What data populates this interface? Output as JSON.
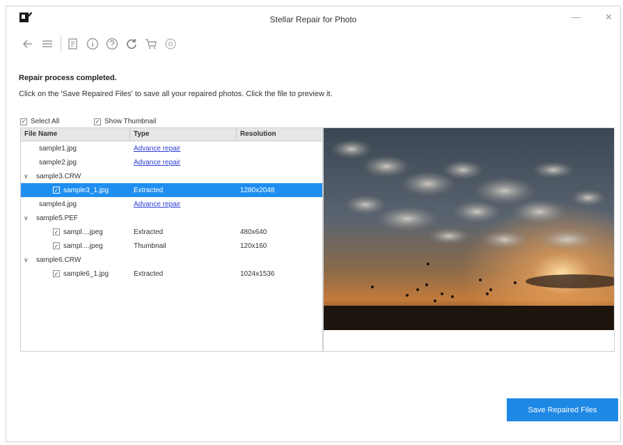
{
  "window": {
    "title": "Stellar Repair for Photo",
    "minimize": "—",
    "close": "✕"
  },
  "toolbar": {
    "icons": [
      "back-arrow-icon",
      "menu-icon",
      "list-icon",
      "info-icon",
      "help-icon",
      "refresh-icon",
      "cart-icon",
      "settings-icon"
    ]
  },
  "main": {
    "heading": "Repair process completed.",
    "instruction": "Click on the 'Save Repaired Files' to save all your repaired photos. Click the file to preview it.",
    "select_all": "Select All",
    "show_thumbnail": "Show Thumbnail"
  },
  "table": {
    "headers": {
      "name": "File Name",
      "type": "Type",
      "resolution": "Resolution"
    },
    "rows": [
      {
        "name": "sample1.jpg",
        "type": "Advance repair",
        "res": ""
      },
      {
        "name": "sample2.jpg",
        "type": "Advance repair",
        "res": ""
      },
      {
        "name": "sample3.CRW",
        "type": "",
        "res": ""
      },
      {
        "name": "sample3_1.jpg",
        "type": "Extracted",
        "res": "1280x2048"
      },
      {
        "name": "sample4.jpg",
        "type": "Advance repair",
        "res": ""
      },
      {
        "name": "sample5.PEF",
        "type": "",
        "res": ""
      },
      {
        "name": "sampl....jpeg",
        "type": "Extracted",
        "res": "480x640"
      },
      {
        "name": "sampl....jpeg",
        "type": "Thumbnail",
        "res": "120x160"
      },
      {
        "name": "sample6.CRW",
        "type": "",
        "res": ""
      },
      {
        "name": "sample6_1.jpg",
        "type": "Extracted",
        "res": "1024x1536"
      }
    ]
  },
  "save_button": "Save Repaired Files",
  "colors": {
    "accent": "#1e88e5",
    "selection": "#1f8ef1",
    "link": "#2b3bd6"
  }
}
